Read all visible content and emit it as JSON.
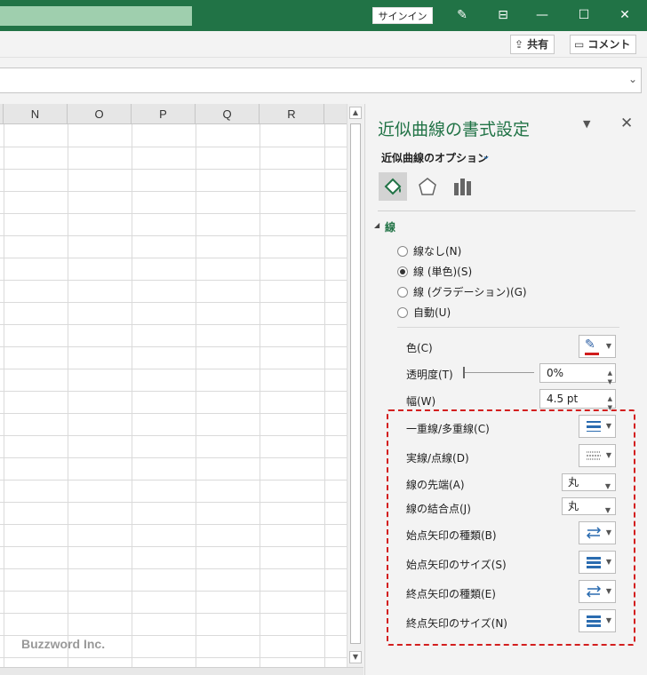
{
  "titlebar": {
    "signin_label": "サインイン"
  },
  "ribbon": {
    "share_label": "共有",
    "comment_label": "コメント"
  },
  "sheet": {
    "columns": [
      "N",
      "O",
      "P",
      "Q",
      "R"
    ]
  },
  "watermark": "Buzzword Inc.",
  "pane": {
    "title": "近似曲線の書式設定",
    "subtitle": "近似曲線のオプション",
    "section": "線",
    "line_options": [
      {
        "label": "線なし(N)",
        "selected": false
      },
      {
        "label": "線 (単色)(S)",
        "selected": true
      },
      {
        "label": "線 (グラデーション)(G)",
        "selected": false
      },
      {
        "label": "自動(U)",
        "selected": false
      }
    ],
    "color_label": "色(C)",
    "color_value": "#d01c1c",
    "transparency_label": "透明度(T)",
    "transparency_value": "0%",
    "width_label": "幅(W)",
    "width_value": "4.5 pt",
    "compound_label": "一重線/多重線(C)",
    "dash_label": "実線/点線(D)",
    "cap_label": "線の先端(A)",
    "cap_value": "丸",
    "join_label": "線の結合点(J)",
    "join_value": "丸",
    "begin_arrow_type_label": "始点矢印の種類(B)",
    "begin_arrow_size_label": "始点矢印のサイズ(S)",
    "end_arrow_type_label": "終点矢印の種類(E)",
    "end_arrow_size_label": "終点矢印のサイズ(N)"
  },
  "colors": {
    "accent": "#217346",
    "highlight": "#d31e1e"
  }
}
